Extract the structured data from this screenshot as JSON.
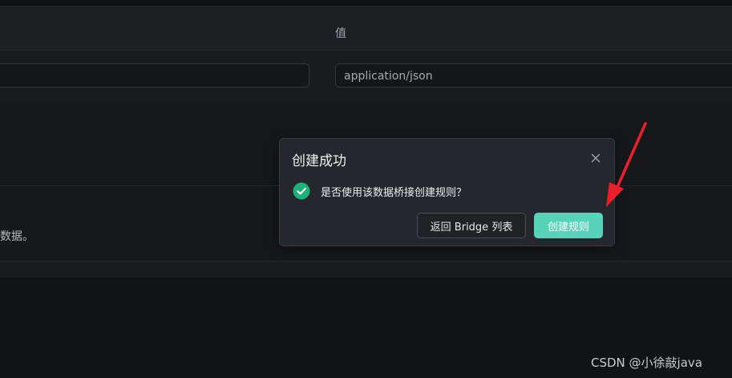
{
  "table": {
    "value_column_header": "值",
    "value_input": "application/json"
  },
  "section": {
    "truncated_text": "数据。"
  },
  "dialog": {
    "title": "创建成功",
    "message": "是否使用该数据桥接创建规则？",
    "back_button_label": "返回 Bridge 列表",
    "create_button_label": "创建规则"
  },
  "watermark": {
    "text": "CSDN @小徐敲java"
  },
  "icons": {
    "close": "close-icon",
    "success": "check-circle-icon",
    "annotation": "red-arrow-icon"
  },
  "colors": {
    "accent": "#57d3b9",
    "success": "#1fb079",
    "annotation_arrow": "#e8202a",
    "background": "#141518",
    "dialog_background": "#25272c"
  }
}
